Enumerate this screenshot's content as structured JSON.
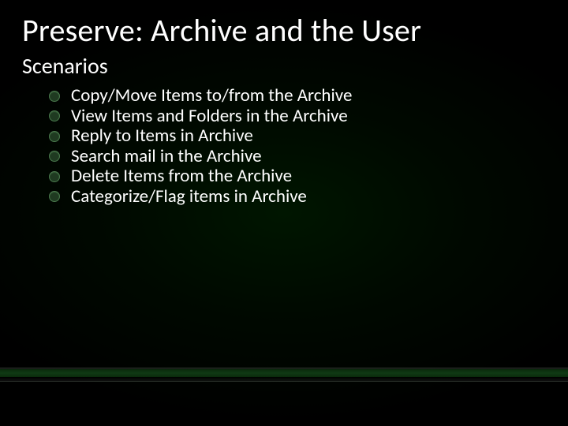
{
  "title": "Preserve: Archive and the User",
  "subtitle": "Scenarios",
  "bullets": [
    "Copy/Move Items to/from the Archive",
    "View Items and Folders in the Archive",
    "Reply to Items in Archive",
    "Search mail in the Archive",
    "Delete Items from the Archive",
    "Categorize/Flag items in Archive"
  ]
}
